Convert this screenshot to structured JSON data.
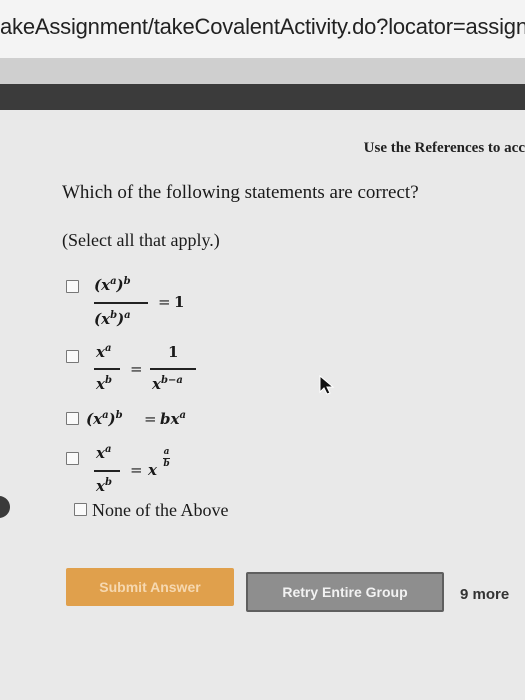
{
  "browser": {
    "url": "akeAssignment/takeCovalentActivity.do?locator=assignm"
  },
  "header": {
    "references_text": "Use the References to acc"
  },
  "question": {
    "text": "Which of the following statements are correct?",
    "instruction": "(Select all that apply.)"
  },
  "options": [
    {
      "label": "(x^a)^b / (x^b)^a = 1",
      "checked": false
    },
    {
      "label": "x^a / x^b = 1 / x^(b-a)",
      "checked": false
    },
    {
      "label": "(x^a)^b = b x^a",
      "checked": false
    },
    {
      "label": "x^a / x^b = x^(a/b)",
      "checked": false
    },
    {
      "label": "None of the Above",
      "checked": false
    }
  ],
  "math": {
    "one": "1",
    "eq": "=",
    "x": "x",
    "a": "a",
    "b": "b",
    "bx": "bx",
    "b_minus_a": "b−a",
    "lparen": "(",
    "rparen": ")"
  },
  "buttons": {
    "submit_label": "Submit Answer",
    "retry_label": "Retry Entire Group",
    "more_text": "9 more"
  },
  "colors": {
    "submit": "#e0a04c",
    "retry": "#8e8e8e",
    "dark_bar": "#3b3b3b"
  }
}
